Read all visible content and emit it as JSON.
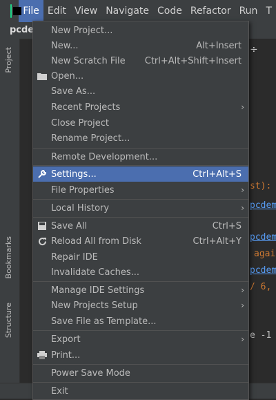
{
  "menubar": {
    "items": [
      "File",
      "Edit",
      "View",
      "Navigate",
      "Code",
      "Refactor",
      "Run",
      "T"
    ]
  },
  "project": {
    "title": "pcde"
  },
  "side_tabs": {
    "project": "Project",
    "bookmarks": "Bookmarks",
    "structure": "Structure"
  },
  "editor_snippets": {
    "s1": "st):",
    "s2": "pcdem",
    "s3": "pcdem",
    "s4": "agai",
    "s5": "pcdem",
    "s6": "/ 6,",
    "s7": "e -1"
  },
  "file_menu": {
    "items": [
      {
        "label": "New Project...",
        "shortcut": ""
      },
      {
        "label": "New...",
        "shortcut": "Alt+Insert"
      },
      {
        "label": "New Scratch File",
        "shortcut": "Ctrl+Alt+Shift+Insert"
      },
      {
        "label": "Open...",
        "shortcut": ""
      },
      {
        "label": "Save As...",
        "shortcut": ""
      },
      {
        "label": "Recent Projects",
        "shortcut": ""
      },
      {
        "label": "Close Project",
        "shortcut": ""
      },
      {
        "label": "Rename Project...",
        "shortcut": ""
      },
      {
        "label": "Remote Development...",
        "shortcut": ""
      },
      {
        "label": "Settings...",
        "shortcut": "Ctrl+Alt+S"
      },
      {
        "label": "File Properties",
        "shortcut": ""
      },
      {
        "label": "Local History",
        "shortcut": ""
      },
      {
        "label": "Save All",
        "shortcut": "Ctrl+S"
      },
      {
        "label": "Reload All from Disk",
        "shortcut": "Ctrl+Alt+Y"
      },
      {
        "label": "Repair IDE",
        "shortcut": ""
      },
      {
        "label": "Invalidate Caches...",
        "shortcut": ""
      },
      {
        "label": "Manage IDE Settings",
        "shortcut": ""
      },
      {
        "label": "New Projects Setup",
        "shortcut": ""
      },
      {
        "label": "Save File as Template...",
        "shortcut": ""
      },
      {
        "label": "Export",
        "shortcut": ""
      },
      {
        "label": "Print...",
        "shortcut": ""
      },
      {
        "label": "Power Save Mode",
        "shortcut": ""
      },
      {
        "label": "Exit",
        "shortcut": ""
      }
    ]
  },
  "colors": {
    "highlight": "#4b6eaf",
    "menu_bg": "#3c3f41",
    "keyword_orange": "#cc7832",
    "link_blue": "#589df6"
  }
}
